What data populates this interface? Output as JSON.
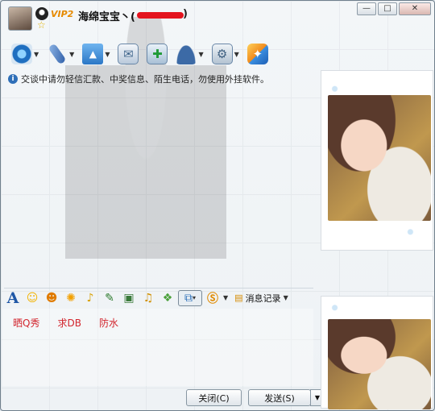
{
  "window": {
    "nickname": "海绵宝宝丶(",
    "nickname_close": ")",
    "vip_level": "VIP2",
    "controls": {
      "minimize": "—",
      "maximize": "□",
      "close": "✕"
    }
  },
  "toolbar": {
    "items": [
      {
        "icon": "webcam-icon",
        "glyph": "◉",
        "color": "#2b7fd1"
      },
      {
        "icon": "microphone-icon",
        "glyph": "🎤",
        "color": "#3c6fbf"
      },
      {
        "icon": "folder-transfer-icon",
        "glyph": "📂",
        "color": "#3f8fd8"
      },
      {
        "icon": "email-icon",
        "glyph": "✉",
        "color": "#6b8fb5"
      },
      {
        "icon": "add-contact-icon",
        "glyph": "✚",
        "color": "#2b9a3b"
      },
      {
        "icon": "user-info-icon",
        "glyph": "👤",
        "color": "#3b6aa5"
      },
      {
        "icon": "settings-icon",
        "glyph": "⚙",
        "color": "#6a7d90"
      },
      {
        "icon": "apps-icon",
        "glyph": "✦",
        "color": "#f2a12b"
      }
    ]
  },
  "notice": {
    "text": "交谈中请勿轻信汇款、中奖信息、陌生电话，勿使用外挂软件。"
  },
  "input_toolbar": {
    "history_label": "消息记录"
  },
  "quick_phrases": [
    "晒Q秀",
    "求DB",
    "防水"
  ],
  "buttons": {
    "close": "关闭(C)",
    "send": "发送(S)"
  },
  "colors": {
    "accent": "#2f6fb8",
    "phrase": "#d2262e",
    "redacted": "#e4141e"
  }
}
